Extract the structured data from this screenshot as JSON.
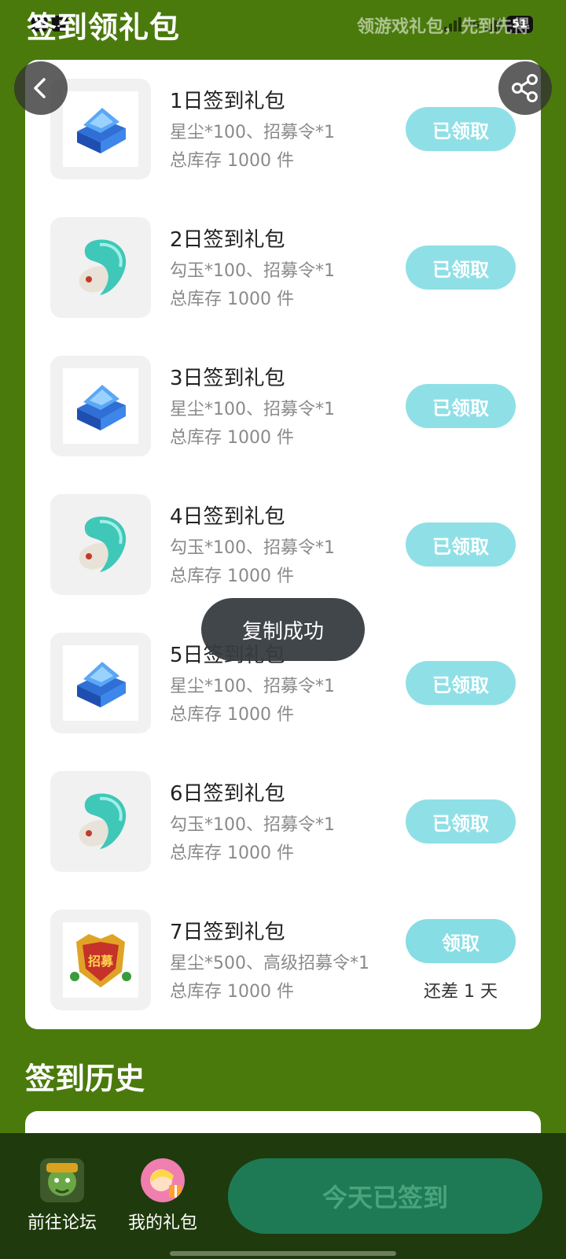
{
  "header": {
    "title": "签到领礼包",
    "slogan": "领游戏礼包，先到先得",
    "battery": "51",
    "network": "4G"
  },
  "gifts": [
    {
      "title": "1日签到礼包",
      "desc": "星尘*100、招募令*1",
      "stock": "总库存 1000 件",
      "button": "已领取",
      "icon": "chest-icon"
    },
    {
      "title": "2日签到礼包",
      "desc": "勾玉*100、招募令*1",
      "stock": "总库存 1000 件",
      "button": "已领取",
      "icon": "magatama-icon"
    },
    {
      "title": "3日签到礼包",
      "desc": "星尘*100、招募令*1",
      "stock": "总库存 1000 件",
      "button": "已领取",
      "icon": "chest-icon"
    },
    {
      "title": "4日签到礼包",
      "desc": "勾玉*100、招募令*1",
      "stock": "总库存 1000 件",
      "button": "已领取",
      "icon": "magatama-icon"
    },
    {
      "title": "5日签到礼包",
      "desc": "星尘*100、招募令*1",
      "stock": "总库存 1000 件",
      "button": "已领取",
      "icon": "chest-icon"
    },
    {
      "title": "6日签到礼包",
      "desc": "勾玉*100、招募令*1",
      "stock": "总库存 1000 件",
      "button": "已领取",
      "icon": "magatama-icon"
    },
    {
      "title": "7日签到礼包",
      "desc": "星尘*500、高级招募令*1",
      "stock": "总库存 1000 件",
      "button": "领取",
      "remain": "还差 1 天",
      "icon": "recruit-token-icon"
    }
  ],
  "toast": "复制成功",
  "history": {
    "title": "签到历史"
  },
  "bottom": {
    "forum_label": "前往论坛",
    "gifts_label": "我的礼包",
    "checkin_label": "今天已签到"
  },
  "colors": {
    "page_bg": "#4a7a0c",
    "button_bg": "#8fe0e6",
    "checkin_bg": "#1e7a55",
    "bottom_bar": "#1f3a0c"
  }
}
